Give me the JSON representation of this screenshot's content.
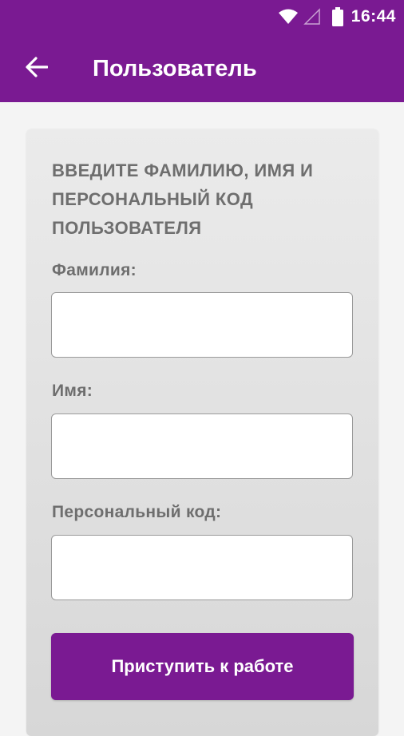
{
  "status_bar": {
    "time": "16:44",
    "icons": [
      "wifi-icon",
      "signal-icon",
      "battery-icon"
    ]
  },
  "app_bar": {
    "title": "Пользователь",
    "back_icon": "arrow-left-icon"
  },
  "form": {
    "instruction": "ВВЕДИТЕ ФАМИЛИЮ, ИМЯ И ПЕРСОНАЛЬНЫЙ КОД ПОЛЬЗОВАТЕЛЯ",
    "fields": [
      {
        "label": "Фамилия:",
        "value": "",
        "placeholder": ""
      },
      {
        "label": "Имя:",
        "value": "",
        "placeholder": ""
      },
      {
        "label": "Персональный код:",
        "value": "",
        "placeholder": ""
      }
    ],
    "submit_label": "Приступить к работе"
  },
  "colors": {
    "accent": "#7a1a92",
    "label_text": "#6e6e6e",
    "background": "#f4f4f4"
  }
}
